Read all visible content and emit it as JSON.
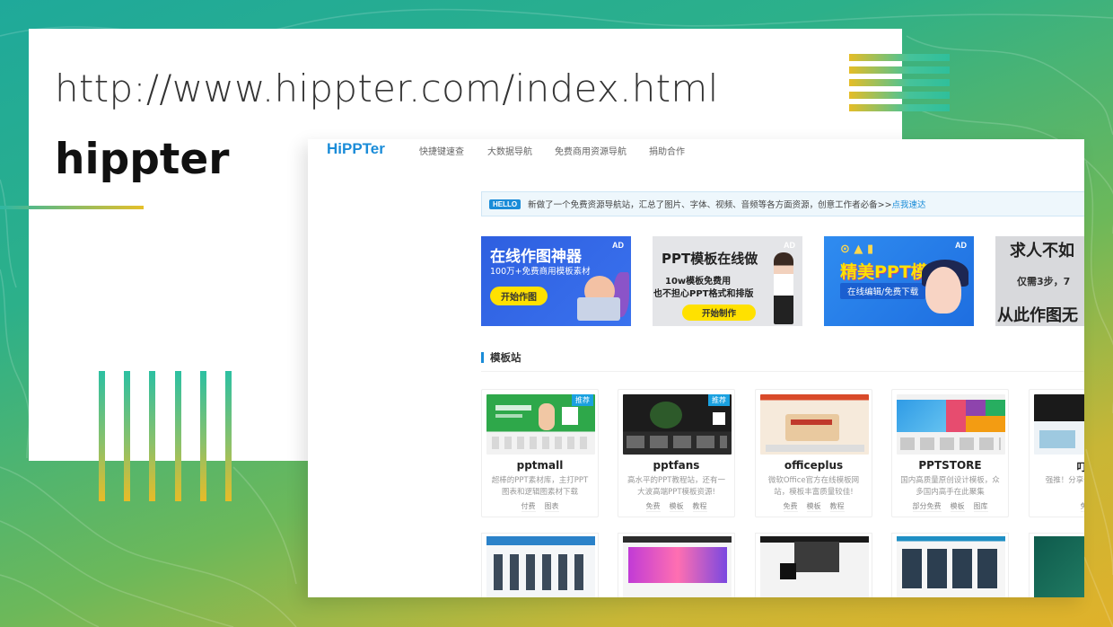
{
  "slide": {
    "url": "http://www.hippter.com/index.html",
    "title": "hippter"
  },
  "site": {
    "logo": "HiPPTer",
    "nav": [
      "快捷键速查",
      "大数据导航",
      "免费商用资源导航",
      "捐助合作"
    ],
    "announcement": {
      "badge": "HELLO",
      "text": "新做了一个免费资源导航站，汇总了图片、字体、视频、音频等各方面资源，创意工作者必备>>",
      "link": "点我速达"
    },
    "ads": [
      {
        "tag": "AD",
        "title": "在线作图神器",
        "subtitle": "100万+免费商用模板素材",
        "button": "开始作图"
      },
      {
        "tag": "AD",
        "title": "PPT模板在线做",
        "line1": "10w模板免费用",
        "line2": "也不担心PPT格式和排版",
        "button": "开始制作"
      },
      {
        "tag": "AD",
        "title": "精美PPT模板",
        "subtitle": "在线编辑/免费下载"
      },
      {
        "title": "求人不如",
        "line1": "仅需3步，7",
        "line2": "从此作图无"
      }
    ],
    "section_title": "模板站",
    "cards": [
      {
        "name": "pptmall",
        "desc": "超棒的PPT素材库，主打PPT图表和逻辑图素材下载",
        "tags": [
          "付费",
          "图表"
        ],
        "badge": "推荐"
      },
      {
        "name": "pptfans",
        "desc": "高水平的PPT教程站，还有一大波高端PPT模板资源!",
        "tags": [
          "免费",
          "模板",
          "教程"
        ],
        "badge": "推荐"
      },
      {
        "name": "officeplus",
        "desc": "微软Office官方在线模板网站，模板丰富质量较佳!",
        "tags": [
          "免费",
          "模板",
          "教程"
        ]
      },
      {
        "name": "PPTSTORE",
        "desc": "国内高质量原创设计模板，众多国内高手在此聚集",
        "tags": [
          "部分免费",
          "模板",
          "图库"
        ]
      },
      {
        "name": "叮当",
        "desc": "强推！分享优质全部模板",
        "tags": [
          "免费"
        ]
      }
    ]
  }
}
